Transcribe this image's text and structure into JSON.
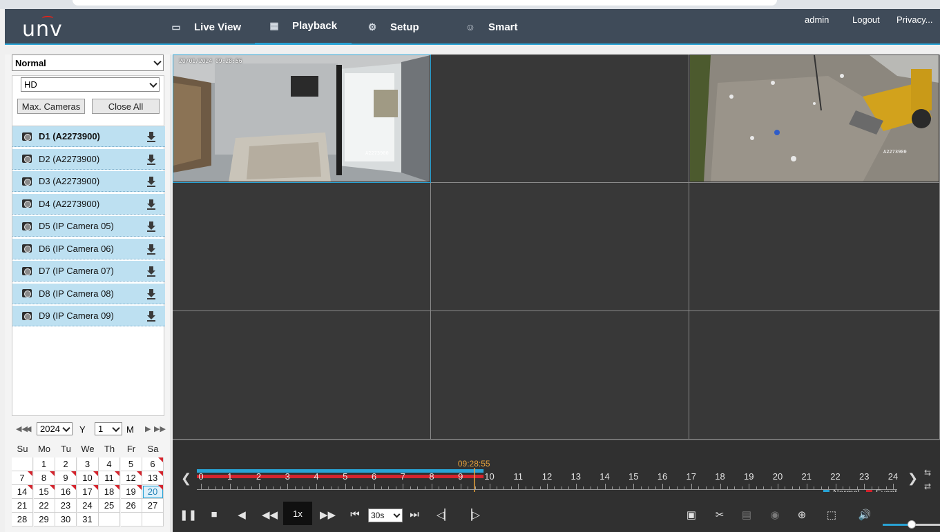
{
  "header": {
    "logo": "unv",
    "nav": [
      {
        "label": "Live View",
        "icon": "monitor-icon"
      },
      {
        "label": "Playback",
        "icon": "film-icon",
        "active": true
      },
      {
        "label": "Setup",
        "icon": "gear-icon"
      },
      {
        "label": "Smart",
        "icon": "smart-person-icon"
      }
    ],
    "user": "admin",
    "logout": "Logout",
    "privacy": "Privacy..."
  },
  "left_panel": {
    "mode_select": "Normal",
    "stream_select": "HD",
    "max_cameras_label": "Max. Cameras",
    "close_all_label": "Close All",
    "cameras": [
      {
        "label": "D1 (A2273900)",
        "active": true
      },
      {
        "label": "D2 (A2273900)"
      },
      {
        "label": "D3 (A2273900)"
      },
      {
        "label": "D4 (A2273900)"
      },
      {
        "label": "D5 (IP Camera 05)"
      },
      {
        "label": "D6 (IP Camera 06)"
      },
      {
        "label": "D7 (IP Camera 07)"
      },
      {
        "label": "D8 (IP Camera 08)"
      },
      {
        "label": "D9 (IP Camera 09)"
      }
    ]
  },
  "calendar": {
    "year": "2024",
    "year_unit": "Y",
    "month": "1",
    "month_unit": "M",
    "weekdays": [
      "Su",
      "Mo",
      "Tu",
      "We",
      "Th",
      "Fr",
      "Sa"
    ],
    "weeks": [
      [
        "",
        "1",
        "2",
        "3",
        "4",
        "5",
        "6"
      ],
      [
        "7",
        "8",
        "9",
        "10",
        "11",
        "12",
        "13"
      ],
      [
        "14",
        "15",
        "16",
        "17",
        "18",
        "19",
        "20"
      ],
      [
        "21",
        "22",
        "23",
        "24",
        "25",
        "26",
        "27"
      ],
      [
        "28",
        "29",
        "30",
        "31",
        "",
        "",
        ""
      ]
    ],
    "days_with_recordings": [
      "6",
      "7",
      "8",
      "9",
      "10",
      "11",
      "12",
      "13",
      "14",
      "15",
      "16",
      "17",
      "18",
      "19",
      "20"
    ],
    "selected_day": "20"
  },
  "video": {
    "tile1_timestamp": "20/01/2024 09:28:56",
    "tile1_camera": "A2273900",
    "tile3_camera": "A2273900"
  },
  "timeline": {
    "current_time": "09:28:55",
    "hours": [
      "0",
      "1",
      "2",
      "3",
      "4",
      "5",
      "6",
      "7",
      "8",
      "9",
      "10",
      "11",
      "12",
      "13",
      "14",
      "15",
      "16",
      "17",
      "18",
      "19",
      "20",
      "21",
      "22",
      "23",
      "24"
    ],
    "recorded_until_hour": 9.8,
    "legend": [
      {
        "label": "Normal",
        "color": "#29a3d5"
      },
      {
        "label": "Event",
        "color": "#d4242d"
      }
    ]
  },
  "controls": {
    "speed": "1x",
    "interval": "30s",
    "volume_level": 0.5
  },
  "colors": {
    "accent": "#29a3d5",
    "event": "#d4242d",
    "header": "#3f4b59",
    "current_time": "#e8a33c"
  }
}
